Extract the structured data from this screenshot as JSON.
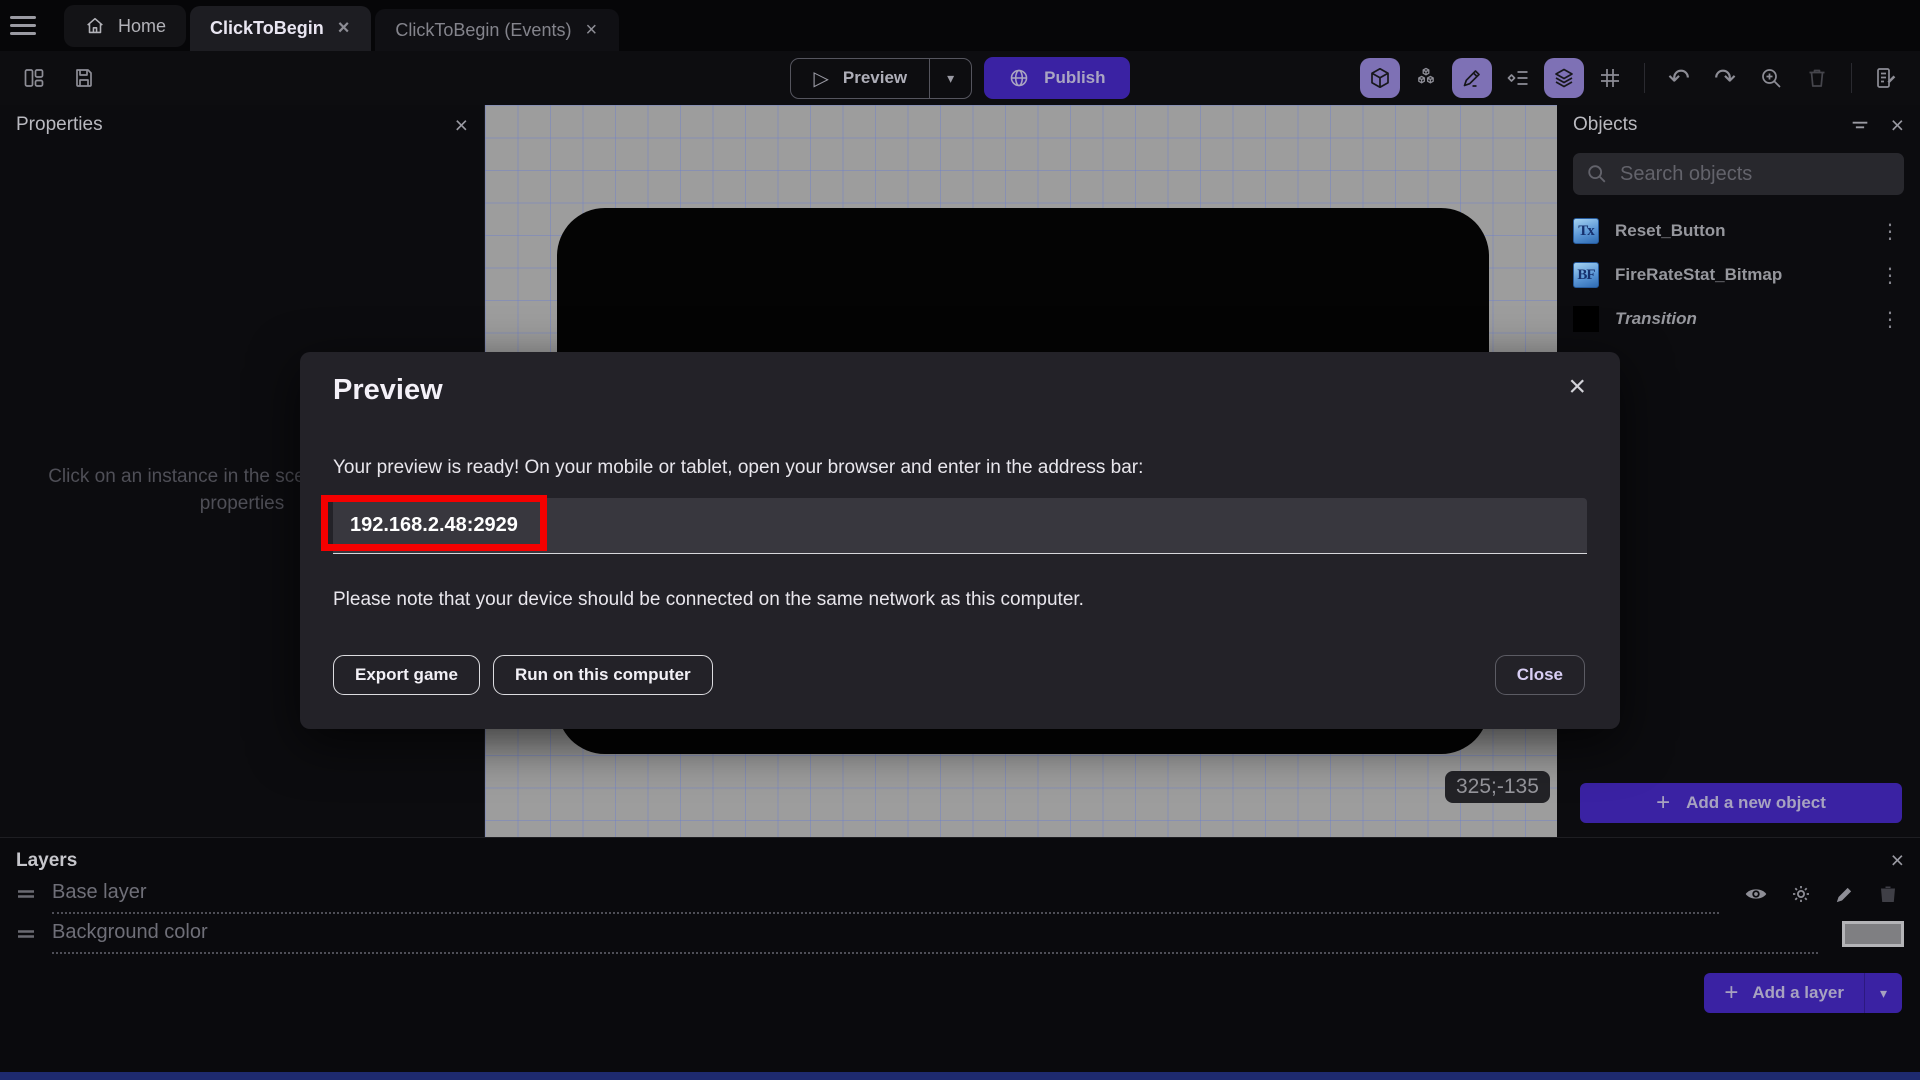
{
  "icons": {
    "kebab": "⋮",
    "close": "×",
    "dropdown": "▾",
    "play": "▷",
    "plus": "+",
    "undo": "↶",
    "redo": "↷"
  },
  "tabbar": {
    "tabs": [
      {
        "label": "Home"
      },
      {
        "label": "ClickToBegin"
      },
      {
        "label": "ClickToBegin (Events)"
      }
    ]
  },
  "toolbar": {
    "preview": "Preview",
    "publish": "Publish"
  },
  "properties_panel": {
    "title": "Properties",
    "placeholder": "Click on an instance in the scene to display its properties"
  },
  "canvas": {
    "coordinates": "325;-135"
  },
  "objects_panel": {
    "title": "Objects",
    "search_placeholder": "Search objects",
    "items": [
      {
        "name": "Reset_Button",
        "icon_text": "Tx"
      },
      {
        "name": "FireRateStat_Bitmap",
        "icon_text": "BF"
      },
      {
        "name": "Transition",
        "icon_text": ""
      }
    ],
    "add_button": "Add a new object"
  },
  "layers_panel": {
    "title": "Layers",
    "layers": [
      {
        "name": "Base layer"
      },
      {
        "name": "Background color"
      }
    ],
    "add_button": "Add a layer"
  },
  "dialog": {
    "title": "Preview",
    "body": "Your preview is ready! On your mobile or tablet, open your browser and enter in the address bar:",
    "address": "192.168.2.48:2929",
    "note": "Please note that your device should be connected on the same network as this computer.",
    "export_button": "Export game",
    "run_button": "Run on this computer",
    "close_button": "Close"
  },
  "colors": {
    "accent_purple": "#3a22a3",
    "toolbar_active_bg": "#7e71b5",
    "annotation_red": "#f40000",
    "canvas_gray": "#9d9d9d",
    "grid_blue": "#6e80cd"
  }
}
